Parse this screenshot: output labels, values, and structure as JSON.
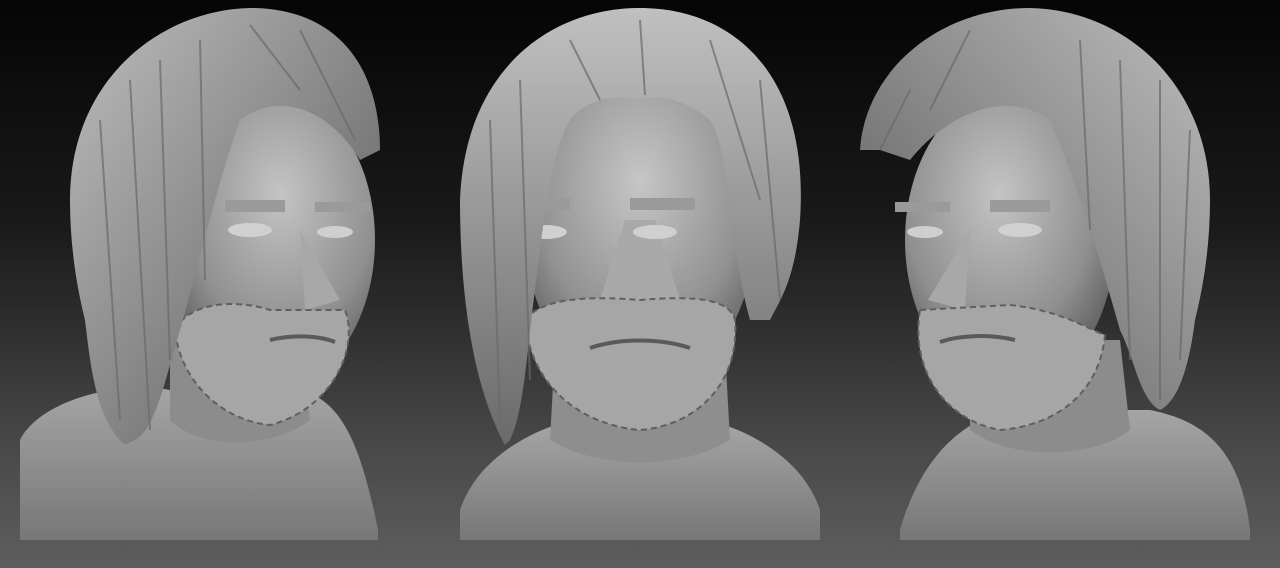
{
  "scene": {
    "background_top": "#050505",
    "background_bottom": "#5e5e5e",
    "material_light": "#b9b9b9",
    "material_mid": "#8e8e8e",
    "material_dark": "#4e4e4e",
    "busts": [
      {
        "view": "three-quarter-right"
      },
      {
        "view": "front"
      },
      {
        "view": "three-quarter-left"
      }
    ]
  }
}
